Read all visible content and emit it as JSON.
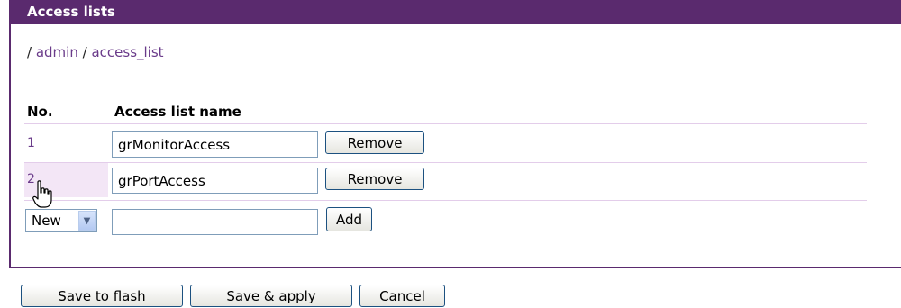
{
  "panel": {
    "title": "Access lists",
    "breadcrumb": {
      "sep1": "/",
      "admin": "admin",
      "sep2": "/",
      "page": "access_list"
    }
  },
  "table": {
    "headers": {
      "no": "No.",
      "name": "Access list name"
    },
    "rows": [
      {
        "no": "1",
        "name": "grMonitorAccess",
        "action": "Remove"
      },
      {
        "no": "2",
        "name": "grPortAccess",
        "action": "Remove"
      }
    ],
    "new_row": {
      "select_value": "New",
      "input_value": "",
      "action": "Add"
    }
  },
  "footer": {
    "save_flash": "Save to flash",
    "save_apply": "Save & apply",
    "cancel": "Cancel"
  },
  "colors": {
    "accent": "#5a2a6e",
    "link": "#6a3b8a",
    "row_line": "#e3cdea",
    "hover": "#f3e6f6"
  },
  "icons": {
    "cursor": "hand-pointer-icon",
    "select_arrow": "chevron-down-icon"
  }
}
